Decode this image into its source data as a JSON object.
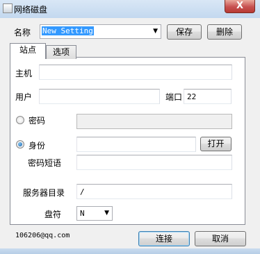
{
  "window": {
    "title": "网络磁盘",
    "close_label": "X"
  },
  "profile": {
    "label": "名称",
    "value": "New Setting",
    "save_label": "保存",
    "delete_label": "删除"
  },
  "tabs": [
    {
      "label": "站点",
      "active": true
    },
    {
      "label": "选项",
      "active": false
    }
  ],
  "site": {
    "host_label": "主机",
    "host_value": "",
    "user_label": "用户",
    "user_value": "",
    "port_label": "端口",
    "port_value": "22",
    "password_label": "密码",
    "password_value": "",
    "identity_label": "身份",
    "identity_value": "",
    "open_label": "打开",
    "passphrase_label": "密码短语",
    "passphrase_value": "",
    "server_dir_label": "服务器目录",
    "server_dir_value": "/",
    "drive_label": "盘符",
    "drive_value": "N",
    "auth_selected": "identity"
  },
  "footer": {
    "contact": "106206@qq.com",
    "connect_label": "连接",
    "cancel_label": "取消"
  }
}
